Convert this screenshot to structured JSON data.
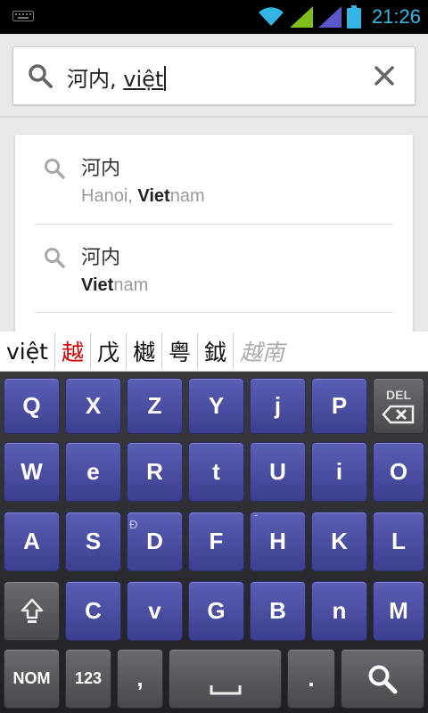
{
  "status_bar": {
    "time": "21:26"
  },
  "search": {
    "query_committed": "河内, ",
    "query_composing": "việt"
  },
  "suggestions": [
    {
      "title": "河内",
      "sub_prefix": "Hanoi, ",
      "sub_bold": "Viet",
      "sub_rest": "nam"
    },
    {
      "title": "河内",
      "sub_prefix": "",
      "sub_bold": "Viet",
      "sub_rest": "nam"
    }
  ],
  "candidates": [
    {
      "text": "việt",
      "style": "normal"
    },
    {
      "text": "越",
      "style": "red"
    },
    {
      "text": "戊",
      "style": "normal"
    },
    {
      "text": "樾",
      "style": "normal"
    },
    {
      "text": "粤",
      "style": "normal"
    },
    {
      "text": "鉞",
      "style": "normal"
    },
    {
      "text": "越南",
      "style": "italic"
    }
  ],
  "keyboard": {
    "row1": [
      "Q",
      "X",
      "Z",
      "Y",
      "j",
      "P"
    ],
    "del_label": "DEL",
    "row2": [
      "W",
      "e",
      "R",
      "t",
      "U",
      "i",
      "O"
    ],
    "row3": [
      "A",
      "S",
      "D",
      "F",
      "H",
      "K",
      "L"
    ],
    "row3_hints": {
      "D": "Đ",
      "H": "ˉ"
    },
    "row4": [
      "C",
      "v",
      "G",
      "B",
      "n",
      "M"
    ],
    "mode_label": "NOM",
    "num_label": "123",
    "comma_label": ",",
    "period_label": ".",
    "accent_colors": {
      "key": "#4a4ea6",
      "status_clock": "#33b5e5",
      "candidate_highlight": "#d40000"
    }
  }
}
